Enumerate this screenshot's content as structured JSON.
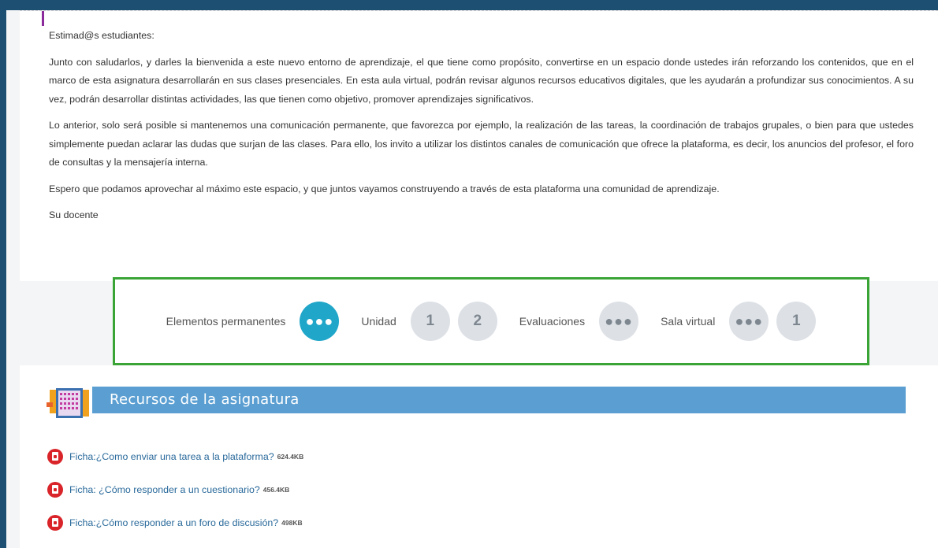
{
  "welcome": {
    "greeting": "Estimad@s estudiantes:",
    "paragraph1": "Junto con saludarlos, y darles la bienvenida a este nuevo entorno de aprendizaje, el que tiene como propósito, convertirse en un espacio donde ustedes irán reforzando los contenidos, que en el marco de esta asignatura desarrollarán en sus clases presenciales. En esta aula virtual, podrán revisar algunos recursos educativos digitales, que les ayudarán a profundizar sus conocimientos. A su vez, podrán desarrollar distintas actividades, las que tienen como objetivo, promover aprendizajes significativos.",
    "paragraph2": "Lo anterior, solo será posible si mantenemos una comunicación permanente, que favorezca por ejemplo, la realización de las tareas, la coordinación de trabajos grupales, o bien para que ustedes simplemente puedan aclarar las dudas que surjan de las clases. Para ello, los invito a utilizar los distintos canales de comunicación que ofrece la plataforma, es decir, los anuncios del profesor, el foro de consultas y la mensajería interna.",
    "paragraph3": "Espero que podamos aprovechar al máximo este espacio, y que juntos vayamos construyendo a través de esta plataforma una comunidad de aprendizaje.",
    "signature": "Su docente"
  },
  "nav": {
    "permanent_label": "Elementos permanentes",
    "permanent_btn": "●●●",
    "unidad_label": "Unidad",
    "unidad_1": "1",
    "unidad_2": "2",
    "evaluaciones_label": "Evaluaciones",
    "evaluaciones_btn": "●●●",
    "sala_label": "Sala virtual",
    "sala_btn": "●●●",
    "sala_1": "1"
  },
  "resources": {
    "title": "Recursos de la asignatura",
    "files": [
      {
        "name": "Ficha:¿Como enviar una tarea a la plataforma?",
        "size": "624.4KB"
      },
      {
        "name": "Ficha: ¿Cómo responder a un cuestionario?",
        "size": "456.4KB"
      },
      {
        "name": "Ficha:¿Cómo responder a un foro de discusión?",
        "size": "498KB"
      }
    ]
  },
  "colors": {
    "background": "#1d4f72",
    "active_circle": "#1fa6c9",
    "inactive_circle": "#dde1e6",
    "highlight_border": "#3aa536",
    "resource_bar": "#5b9fd2",
    "pdf_icon": "#d9252a",
    "link": "#2a6a9b"
  }
}
